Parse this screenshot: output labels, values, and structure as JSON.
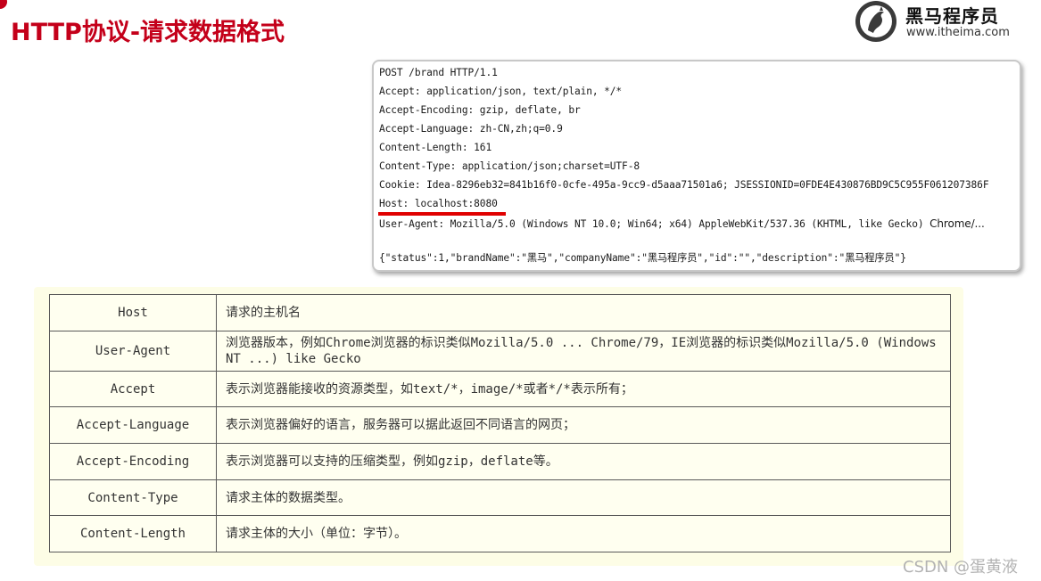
{
  "slide": {
    "title": "HTTP协议-请求数据格式"
  },
  "logo": {
    "name": "黑马程序员",
    "url": "www.itheima.com"
  },
  "request": {
    "lines": [
      "POST /brand HTTP/1.1",
      "Accept: application/json, text/plain, */*",
      "Accept-Encoding: gzip, deflate, br",
      "Accept-Language: zh-CN,zh;q=0.9",
      "Content-Length: 161",
      "Content-Type: application/json;charset=UTF-8",
      "Cookie: Idea-8296eb32=841b16f0-0cfe-495a-9cc9-d5aaa71501a6; JSESSIONID=0FDE4E430876BD9C5C955F061207386F",
      "Host: localhost:8080",
      "User-Agent: Mozilla/5.0 (Windows NT 10.0; Win64; x64) AppleWebKit/537.36 (KHTML, like Gecko)"
    ],
    "user_agent_tail": "Chrome/...",
    "body": "{\"status\":1,\"brandName\":\"黑马\",\"companyName\":\"黑马程序员\",\"id\":\"\",\"description\":\"黑马程序员\"}",
    "highlight_color": "#e00000"
  },
  "headers_table": {
    "rows": [
      {
        "name": "Host",
        "desc": "请求的主机名"
      },
      {
        "name": "User-Agent",
        "desc": "浏览器版本，例如Chrome浏览器的标识类似Mozilla/5.0 ... Chrome/79，IE浏览器的标识类似Mozilla/5.0 (Windows NT ...) like Gecko"
      },
      {
        "name": "Accept",
        "desc": "表示浏览器能接收的资源类型，如text/*，image/*或者*/*表示所有；"
      },
      {
        "name": "Accept-Language",
        "desc": "表示浏览器偏好的语言，服务器可以据此返回不同语言的网页；"
      },
      {
        "name": "Accept-Encoding",
        "desc": "表示浏览器可以支持的压缩类型，例如gzip，deflate等。"
      },
      {
        "name": "Content-Type",
        "desc": "请求主体的数据类型。"
      },
      {
        "name": "Content-Length",
        "desc": "请求主体的大小（单位：字节）。"
      }
    ]
  },
  "watermark": "CSDN @蛋黄液",
  "colors": {
    "title_red": "#c4001a",
    "table_bg": "#fdfde6",
    "border": "#595959"
  }
}
